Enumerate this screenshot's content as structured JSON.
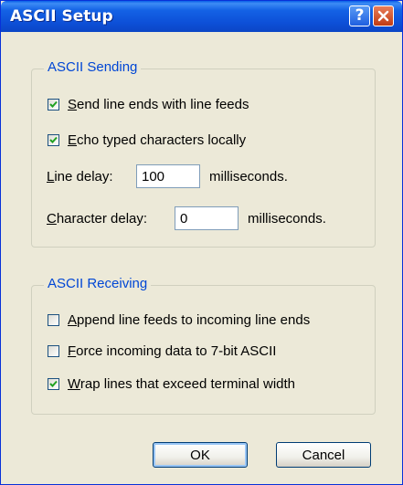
{
  "window": {
    "title": "ASCII Setup"
  },
  "sending": {
    "legend": "ASCII Sending",
    "send_line_ends": {
      "ul": "S",
      "rest": "end line ends with line feeds",
      "checked": true
    },
    "echo_locally": {
      "ul": "E",
      "rest": "cho typed characters locally",
      "checked": true
    },
    "line_delay": {
      "ul": "L",
      "rest": "ine delay:",
      "value": "100",
      "unit": "milliseconds."
    },
    "char_delay": {
      "ul": "C",
      "rest": "haracter delay:",
      "value": "0",
      "unit": "milliseconds."
    }
  },
  "receiving": {
    "legend": "ASCII Receiving",
    "append_line_feeds": {
      "ul": "A",
      "rest": "ppend line feeds to incoming line ends",
      "checked": false
    },
    "force_7bit": {
      "ul": "F",
      "rest": "orce incoming data to 7-bit ASCII",
      "checked": false
    },
    "wrap_lines": {
      "ul": "W",
      "rest": "rap lines that exceed terminal width",
      "checked": true
    }
  },
  "buttons": {
    "ok": "OK",
    "cancel": "Cancel"
  },
  "icons": {
    "help": "help-icon",
    "close": "close-icon",
    "check": "checkmark-icon"
  },
  "colors": {
    "titlebar": "#0a5fe8",
    "face": "#ece9d8",
    "legend": "#0046d5",
    "check": "#21a121"
  }
}
